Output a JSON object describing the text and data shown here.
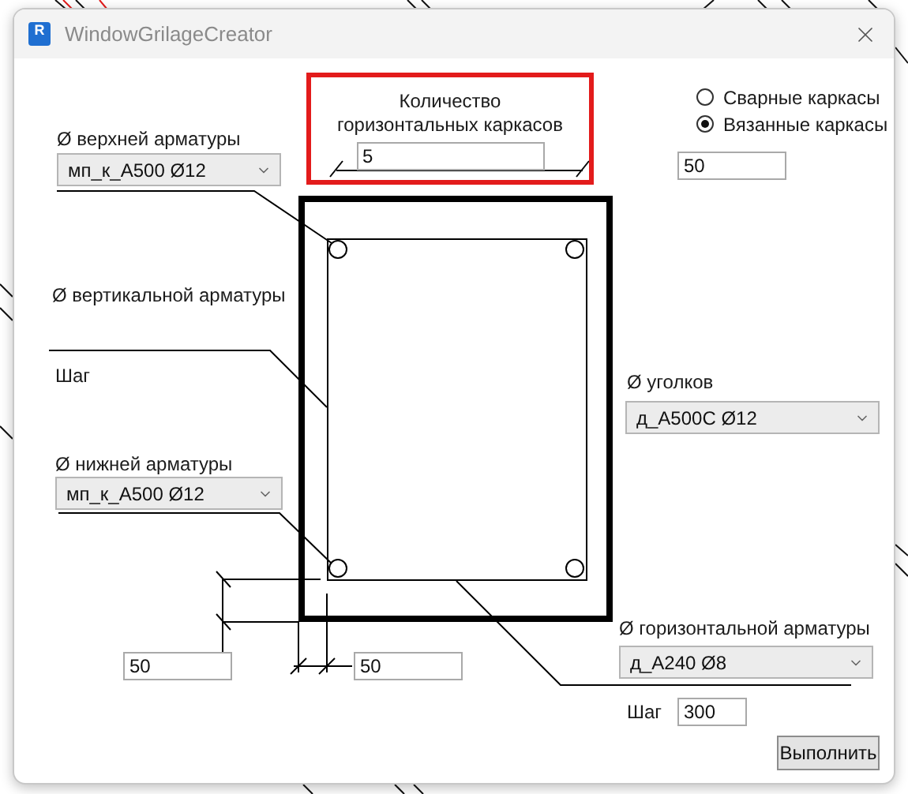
{
  "window": {
    "title": "WindowGrilageCreator",
    "icon_letter": "R"
  },
  "count_group": {
    "label_lines": [
      "Количество",
      "горизонтальных каркасов"
    ],
    "value": "5"
  },
  "frame_types": [
    {
      "label": "Сварные каркасы",
      "selected": false
    },
    {
      "label": "Вязанные каркасы",
      "selected": true
    }
  ],
  "frame_cover": {
    "value": "50"
  },
  "top_rebar": {
    "label": "Ø верхней арматуры",
    "value": "мп_к_A500 Ø12"
  },
  "vertical_rebar": {
    "label": "Ø вертикальной арматуры"
  },
  "vertical_step": {
    "label": "Шаг"
  },
  "bottom_rebar": {
    "label": "Ø нижней арматуры",
    "value": "мп_к_A500 Ø12"
  },
  "cover_bottom": {
    "value": "50"
  },
  "cover_side": {
    "value": "50"
  },
  "corner_rebar": {
    "label": "Ø уголков",
    "value": "д_A500C Ø12"
  },
  "horizontal_rebar": {
    "label": "Ø горизонтальной арматуры",
    "value": "д_A240 Ø8"
  },
  "horizontal_step": {
    "label": "Шаг",
    "value": "300"
  },
  "buttons": [
    "Выполнить"
  ]
}
